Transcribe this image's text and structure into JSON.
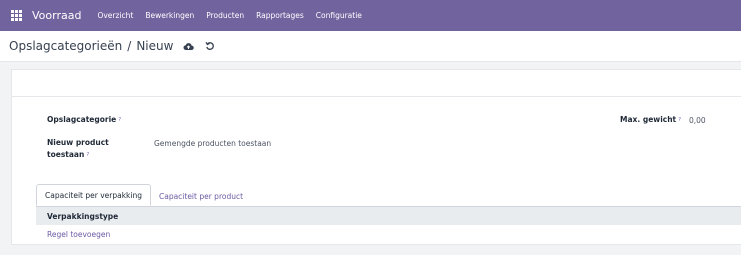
{
  "navbar": {
    "app_name": "Voorraad",
    "menu": [
      "Overzicht",
      "Bewerkingen",
      "Producten",
      "Rapportages",
      "Configuratie"
    ]
  },
  "breadcrumb": {
    "parent": "Opslagcategorieën",
    "separator": "/",
    "current": "Nieuw"
  },
  "form": {
    "fields": {
      "storage_category": {
        "label": "Opslagcategorie",
        "help": "?",
        "value": ""
      },
      "max_weight": {
        "label": "Max. gewicht",
        "help": "?",
        "value": "0,00"
      },
      "allow_new_product": {
        "label_line1": "Nieuw product",
        "label_line2": "toestaan",
        "help": "?",
        "value": "Gemengde producten toestaan"
      }
    },
    "tabs": [
      "Capaciteit per verpakking",
      "Capaciteit per product"
    ],
    "table": {
      "columns": [
        "Verpakkingstype"
      ],
      "add_line": "Regel toevoegen"
    }
  },
  "colors": {
    "navbar": "#71639e",
    "link": "#6b5aa3",
    "background": "#f1f3f5"
  },
  "icons": [
    "apps-grid-icon",
    "cloud-upload-icon",
    "discard-icon"
  ]
}
